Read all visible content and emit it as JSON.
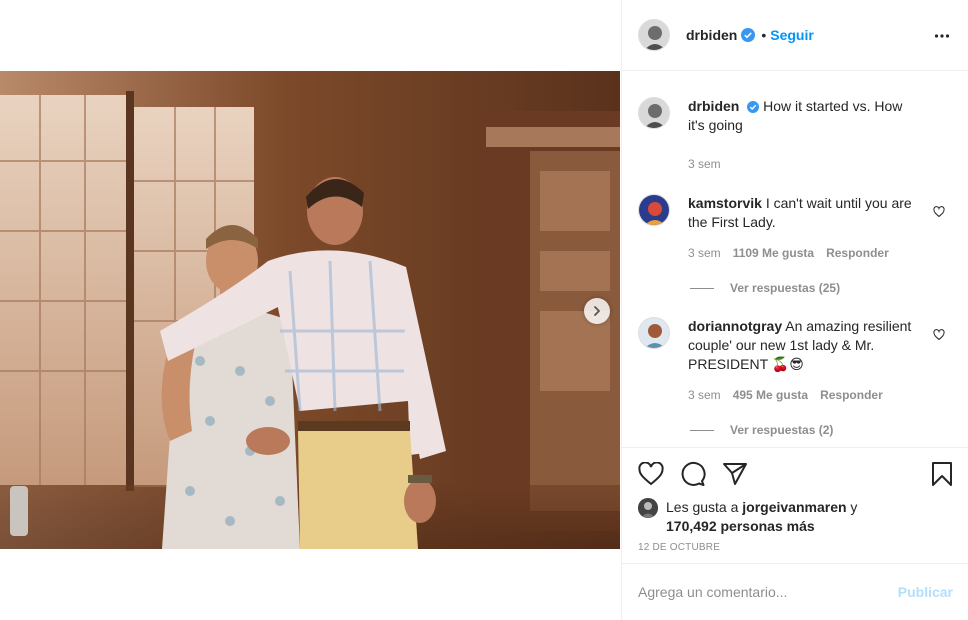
{
  "post": {
    "username": "drbiden",
    "follow_label": "Seguir",
    "separator": "•",
    "caption_text": "How it started vs. How it's going",
    "caption_time": "3 sem"
  },
  "comments": [
    {
      "username": "kamstorvik",
      "text": "I can't wait until you are the First Lady.",
      "time": "3 sem",
      "likes": "1109 Me gusta",
      "reply_label": "Responder",
      "view_replies": "Ver respuestas (25)"
    },
    {
      "username": "doriannotgray",
      "text": "An amazing resilient couple' our new 1st lady & Mr. PRESIDENT 🍒😎",
      "time": "3 sem",
      "likes": "495 Me gusta",
      "reply_label": "Responder",
      "view_replies": "Ver respuestas (2)"
    }
  ],
  "likes_info": {
    "prefix": "Les gusta a ",
    "liker": "jorgeivanmaren",
    "joiner": " y",
    "others": "170,492 personas más"
  },
  "date": "12 DE OCTUBRE",
  "add_comment": {
    "placeholder": "Agrega un comentario...",
    "publish_label": "Publicar"
  },
  "colors": {
    "accent": "#0095f6",
    "publish_disabled": "#b2dffc",
    "muted": "#8e8e8e",
    "verified": "#3897f0"
  },
  "icons": [
    "verified-icon",
    "more-icon",
    "heart-icon",
    "comment-icon",
    "share-icon",
    "bookmark-icon",
    "chevron-right-icon"
  ]
}
